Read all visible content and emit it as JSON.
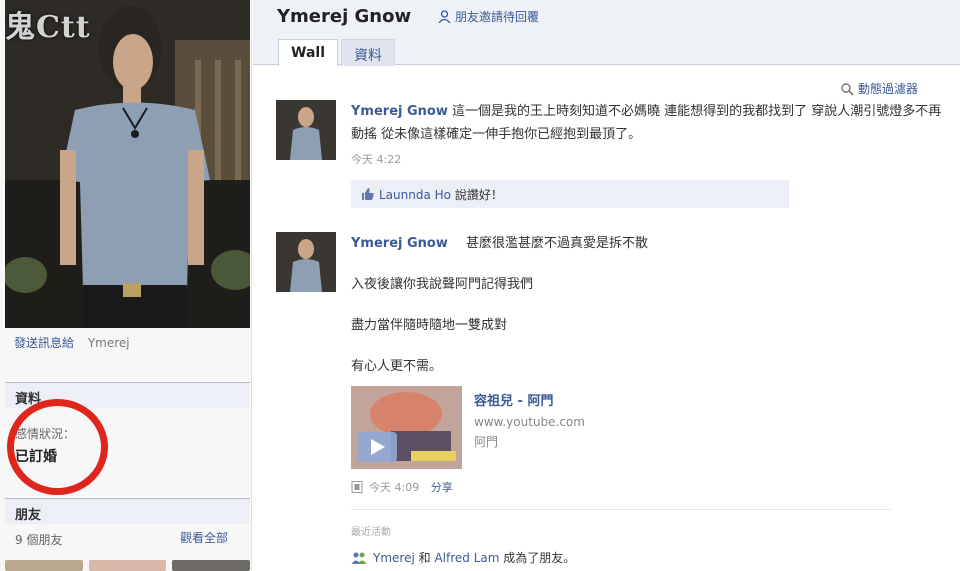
{
  "watermark": "鬼Ctt",
  "sidebar": {
    "caption_link": "發送訊息給",
    "caption_name": "Ymerej",
    "info_header": "資料",
    "relationship_label": "感情狀況：",
    "relationship_value": "已訂婚",
    "friends_header": "朋友",
    "friends_count": "9 個朋友",
    "see_all": "觀看全部"
  },
  "header": {
    "name": "Ymerej Gnow",
    "status": "朋友邀請待回覆",
    "tabs": [
      {
        "label": "Wall"
      },
      {
        "label": "資料"
      }
    ],
    "filter": "動態過濾器"
  },
  "posts": [
    {
      "author": "Ymerej Gnow",
      "text": "這一個是我的王上時刻知道不必媽曉 連能想得到的我都找到了 穿說人潮引號燈多不再動搖 從未像這樣確定一伸手抱你已經抱到最頂了。",
      "time": "今天 4:22",
      "likes_name": "Launnda Ho",
      "likes_suffix": "說讚好！"
    },
    {
      "author": "Ymerej Gnow",
      "lines": [
        "甚麼很濫甚麼不過真愛是拆不散",
        "入夜後讓你我說聲阿門記得我們",
        "盡力當伴隨時隨地一雙成對",
        "有心人更不需。"
      ],
      "video": {
        "title": "容祖兒 - 阿門",
        "domain": "www.youtube.com",
        "subtitle": "阿門"
      },
      "time": "今天 4:09",
      "share": "分享"
    }
  ],
  "recent": {
    "label": "最近活動",
    "activity_name1": "Ymerej",
    "activity_and": "和",
    "activity_name2": "Alfred Lam",
    "activity_suffix": "成為了朋友。"
  },
  "colors": {
    "link": "#3b5998",
    "highlight_circle": "#e0251d",
    "header_band": "#eef1f6"
  }
}
